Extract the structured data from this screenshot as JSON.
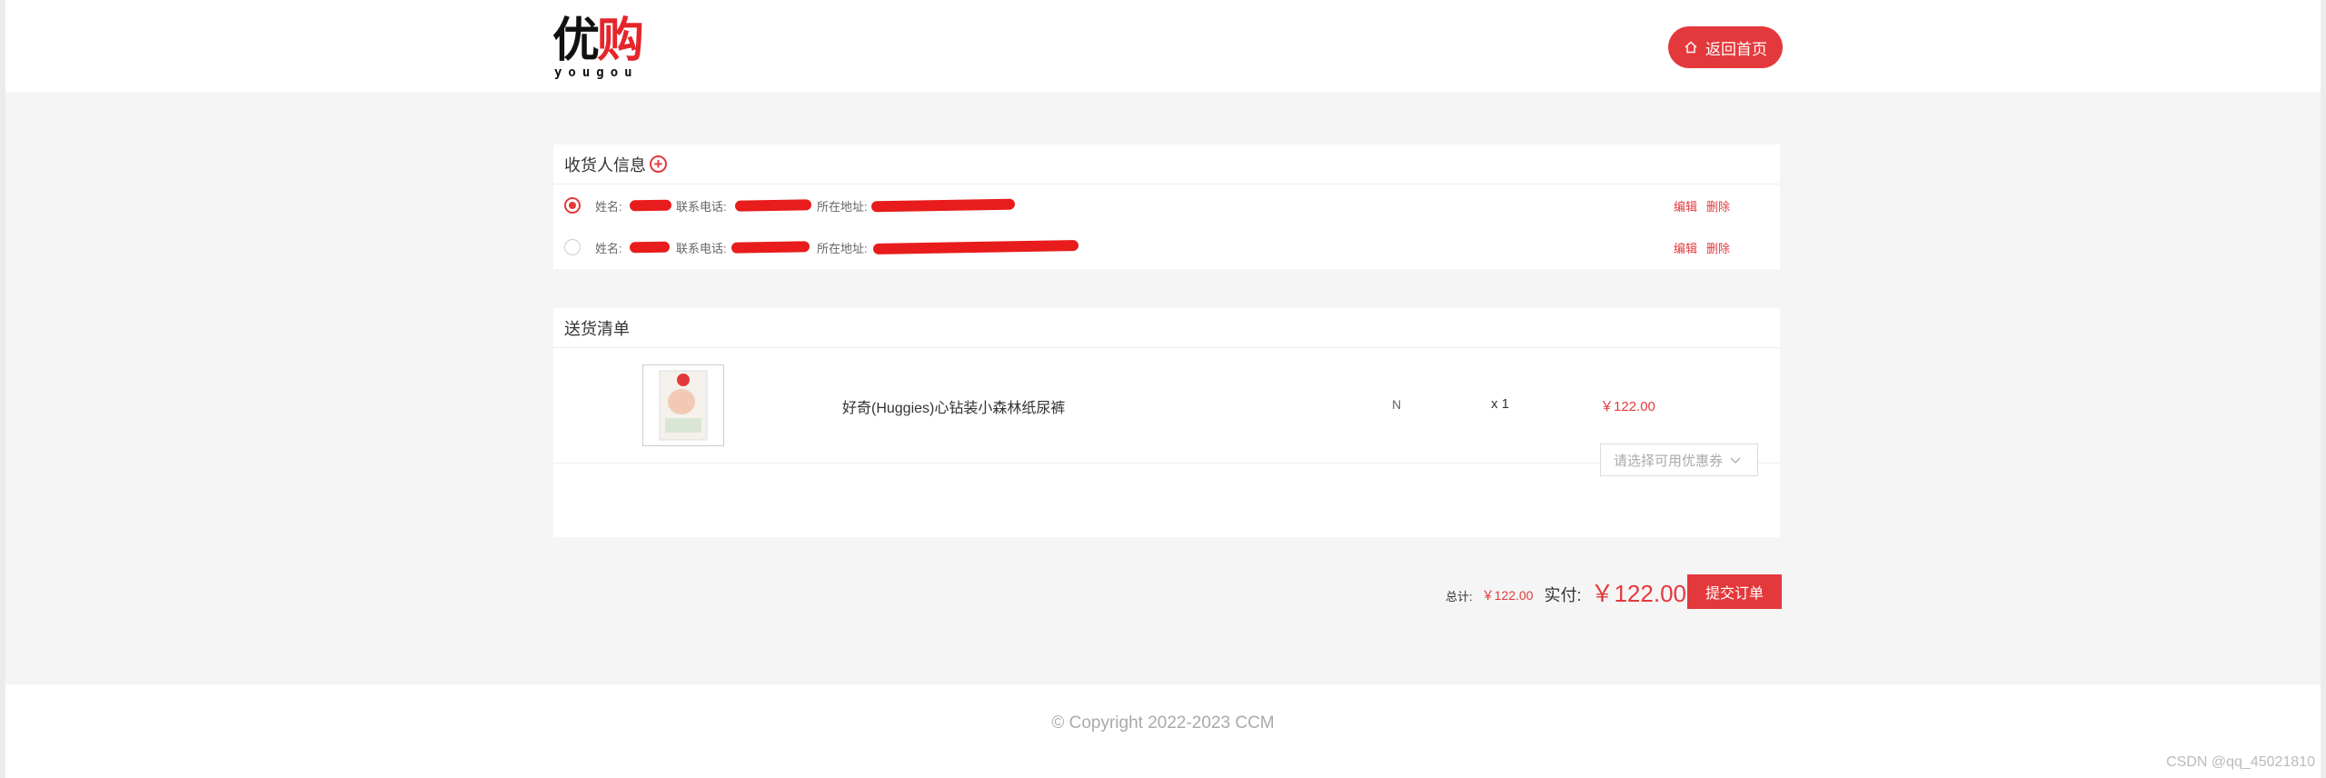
{
  "header": {
    "logo_cn_1": "优",
    "logo_cn_2": "购",
    "logo_en": "yougou",
    "home_button": "返回首页"
  },
  "address": {
    "title": "收货人信息",
    "name_label": "姓名:",
    "phone_label": "联系电话:",
    "addr_label": "所在地址:",
    "edit": "编辑",
    "delete": "删除",
    "rows": [
      {
        "selected": true
      },
      {
        "selected": false
      }
    ]
  },
  "goods": {
    "title": "送货清单",
    "items": [
      {
        "name": "好奇(Huggies)心钻装小森林纸尿裤",
        "spec": "N",
        "qty": "x 1",
        "price": "￥122.00"
      }
    ],
    "coupon_placeholder": "请选择可用优惠券"
  },
  "summary": {
    "total_label": "总计:",
    "total": "￥122.00",
    "actual_label": "实付:",
    "actual": "￥122.00",
    "submit": "提交订单"
  },
  "footer": {
    "copyright": "© Copyright 2022-2023 CCM"
  },
  "watermark": "CSDN @qq_45021810",
  "colors": {
    "accent": "#e4393c",
    "background": "#f5f5f5"
  }
}
